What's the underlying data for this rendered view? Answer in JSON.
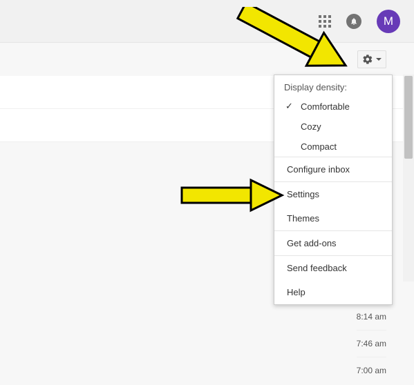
{
  "header": {
    "avatar_letter": "M"
  },
  "dropdown": {
    "header": "Display density:",
    "density": {
      "comfortable": "Comfortable",
      "cozy": "Cozy",
      "compact": "Compact"
    },
    "configure_inbox": "Configure inbox",
    "settings": "Settings",
    "themes": "Themes",
    "get_addons": "Get add-ons",
    "send_feedback": "Send feedback",
    "help": "Help"
  },
  "timestamps": [
    "8:14 am",
    "7:46 am",
    "7:00 am"
  ]
}
